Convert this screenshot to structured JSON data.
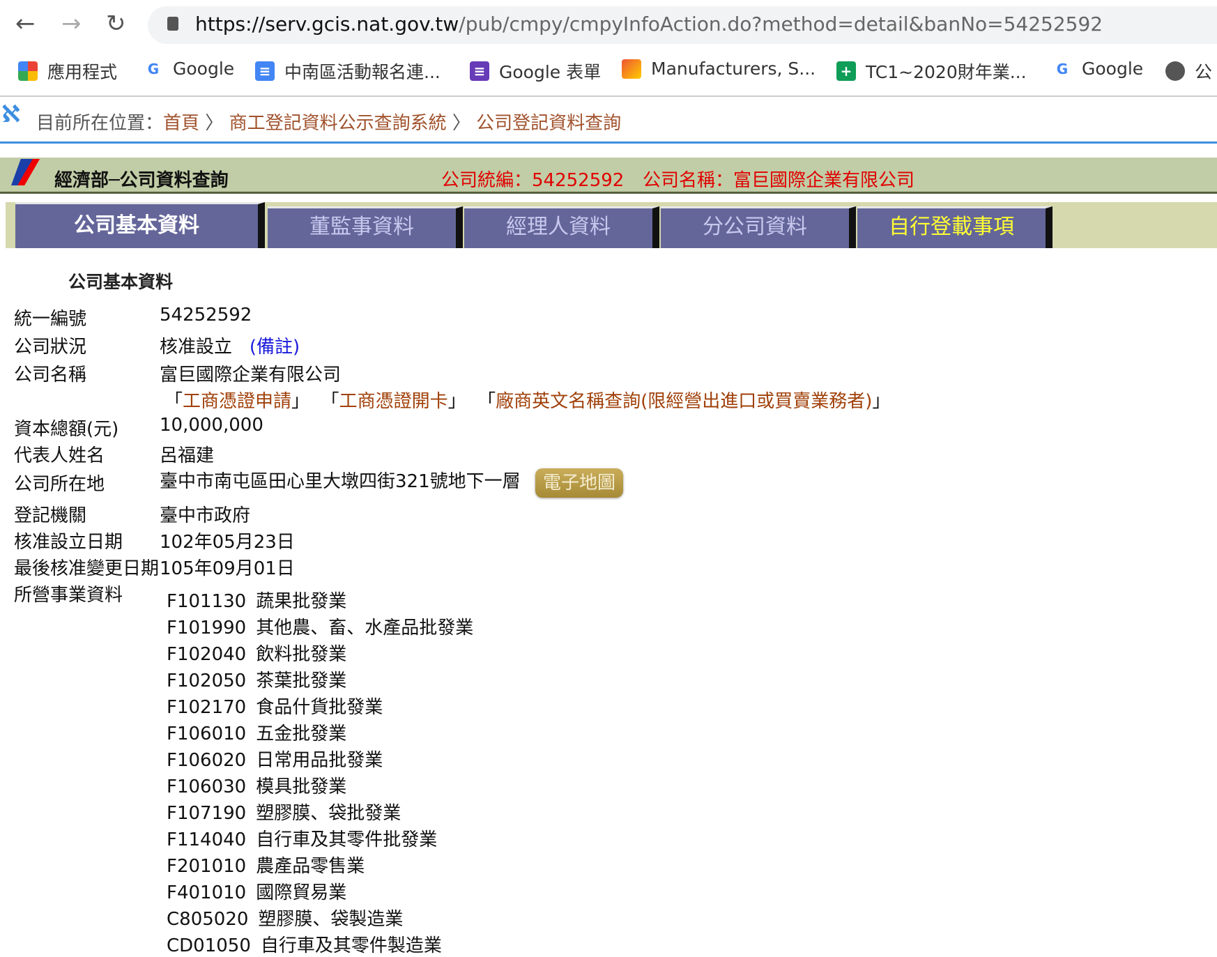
{
  "browser": {
    "url_host": "https://serv.gcis.nat.gov.tw",
    "url_path": "/pub/cmpy/cmpyInfoAction.do?method=detail&banNo=54252592",
    "bookmarks": [
      {
        "label": "應用程式",
        "icon": "apps-grid-icon"
      },
      {
        "label": "Google",
        "icon": "google-icon"
      },
      {
        "label": "中南區活動報名連...",
        "icon": "docs-icon"
      },
      {
        "label": "Google 表單",
        "icon": "forms-icon"
      },
      {
        "label": "Manufacturers, S...",
        "icon": "site-icon"
      },
      {
        "label": "TC1~2020財年業...",
        "icon": "sheets-plus-icon"
      },
      {
        "label": "Google",
        "icon": "google-icon"
      },
      {
        "label": "公",
        "icon": "globe-icon"
      }
    ]
  },
  "breadcrumb": {
    "prefix": "目前所在位置：",
    "items": [
      "首頁",
      "商工登記資料公示查詢系統",
      "公司登記資料查詢"
    ],
    "separator": "〉"
  },
  "header": {
    "title": "經濟部─公司資料查詢",
    "ban_label": "公司統編：54252592",
    "name_label": "公司名稱：富巨國際企業有限公司"
  },
  "tabs": [
    {
      "label": "公司基本資料",
      "active": true
    },
    {
      "label": "董監事資料"
    },
    {
      "label": "經理人資料"
    },
    {
      "label": "分公司資料"
    },
    {
      "label": "自行登載事項",
      "color": "#ffff33"
    }
  ],
  "section_title": "公司基本資料",
  "fields": {
    "ban": {
      "label": "統一編號",
      "value": "54252592"
    },
    "status": {
      "label": "公司狀況",
      "value": "核准設立",
      "note": "(備註)"
    },
    "name": {
      "label": "公司名稱",
      "value": "富巨國際企業有限公司",
      "links": [
        "工商憑證申請",
        "工商憑證開卡",
        "廠商英文名稱查詢(限經營出進口或買賣業務者)"
      ]
    },
    "capital": {
      "label": "資本總額(元)",
      "value": "10,000,000"
    },
    "rep": {
      "label": "代表人姓名",
      "value": "呂福建"
    },
    "address": {
      "label": "公司所在地",
      "value": "臺中市南屯區田心里大墩四街321號地下一層",
      "map_button": "電子地圖"
    },
    "authority": {
      "label": "登記機關",
      "value": "臺中市政府"
    },
    "approved": {
      "label": "核准設立日期",
      "value": "102年05月23日"
    },
    "changed": {
      "label": "最後核准變更日期",
      "value": "105年09月01日"
    },
    "business_label": "所營事業資料"
  },
  "business": [
    {
      "code": "F101130",
      "name": "蔬果批發業"
    },
    {
      "code": "F101990",
      "name": "其他農、畜、水產品批發業"
    },
    {
      "code": "F102040",
      "name": "飲料批發業"
    },
    {
      "code": "F102050",
      "name": "茶葉批發業"
    },
    {
      "code": "F102170",
      "name": "食品什貨批發業"
    },
    {
      "code": "F106010",
      "name": "五金批發業"
    },
    {
      "code": "F106020",
      "name": "日常用品批發業"
    },
    {
      "code": "F106030",
      "name": "模具批發業"
    },
    {
      "code": "F107190",
      "name": "塑膠膜、袋批發業"
    },
    {
      "code": "F114040",
      "name": "自行車及其零件批發業"
    },
    {
      "code": "F201010",
      "name": "農產品零售業"
    },
    {
      "code": "F401010",
      "name": "國際貿易業"
    },
    {
      "code": "C805020",
      "name": "塑膠膜、袋製造業"
    },
    {
      "code": "CD01050",
      "name": "自行車及其零件製造業"
    }
  ]
}
